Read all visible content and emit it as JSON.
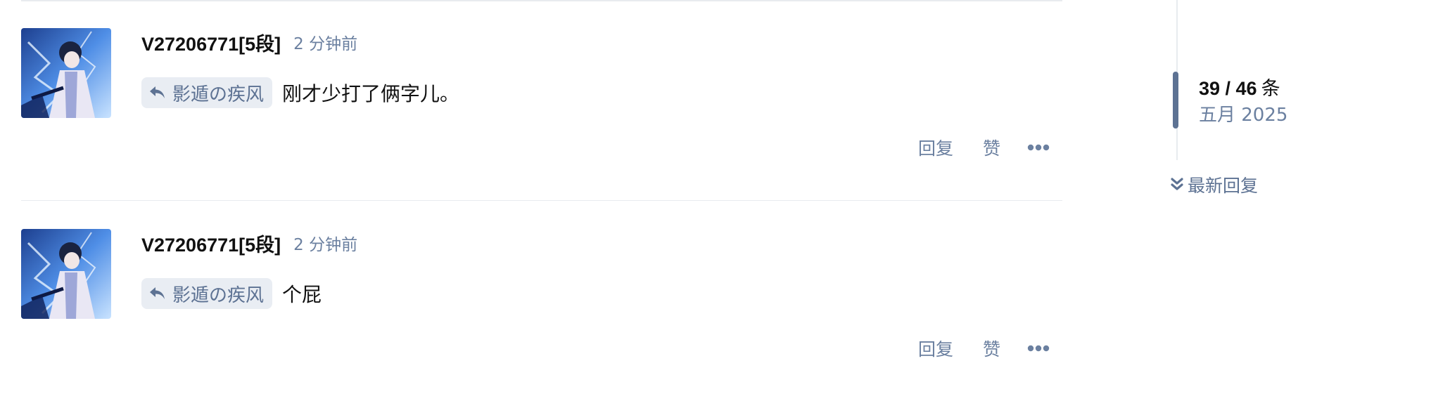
{
  "posts": [
    {
      "username": "V27206771[5段]",
      "time": "2 分钟前",
      "reply_to": "影遁の疾风",
      "text": "刚才少打了俩字儿。",
      "actions": {
        "reply": "回复",
        "like": "赞",
        "more": "•••"
      }
    },
    {
      "username": "V27206771[5段]",
      "time": "2 分钟前",
      "reply_to": "影遁の疾风",
      "text": "个屁",
      "actions": {
        "reply": "回复",
        "like": "赞",
        "more": "•••"
      }
    }
  ],
  "timeline": {
    "count": "39 / 46",
    "unit": "条",
    "date": "五月 2025",
    "latest": "最新回复"
  },
  "icons": {
    "reply_arrow": "reply-arrow-icon",
    "latest": "double-chevron-down-icon",
    "more": "more-dots-icon"
  },
  "colors": {
    "muted": "#6b80a0",
    "accent": "#5d7293",
    "tag_bg": "#e9edf3",
    "divider": "#e8ebef"
  }
}
